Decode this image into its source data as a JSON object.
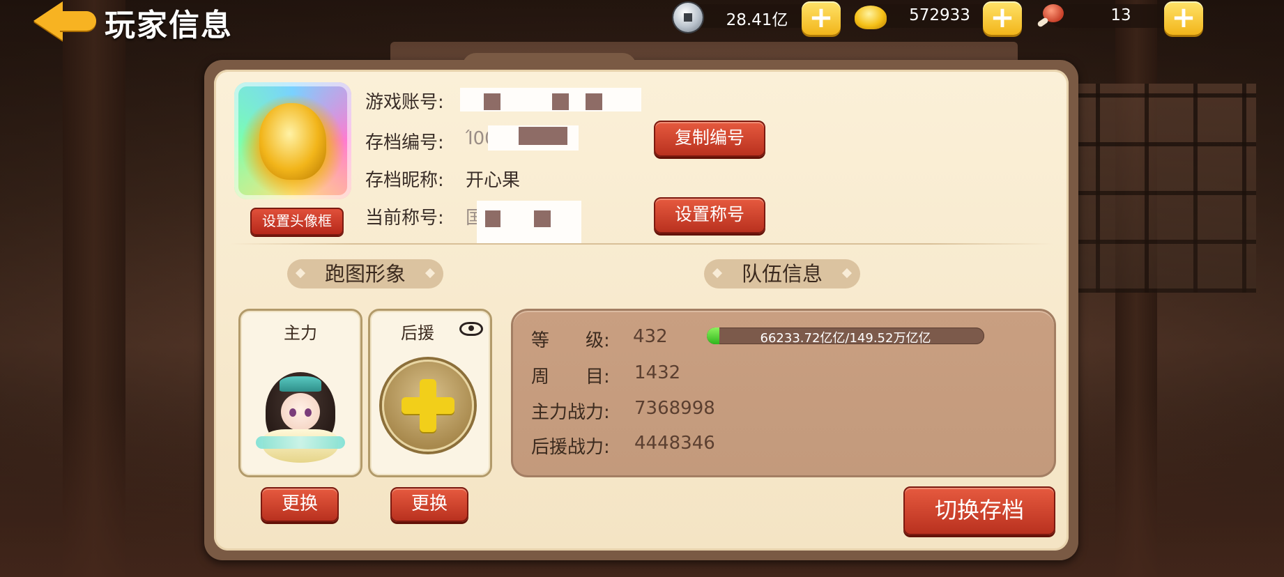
{
  "header": {
    "title": "玩家信息"
  },
  "resources": [
    {
      "name": "silver-coin",
      "value": "28.41亿",
      "icon": "silver-coin-icon"
    },
    {
      "name": "gold-ingot",
      "value": "572933",
      "icon": "gold-ingot-icon"
    },
    {
      "name": "meat",
      "value": "13",
      "icon": "meat-drumstick-icon"
    }
  ],
  "profile": {
    "account_label": "游戏账号:",
    "save_id_label": "存档编号:",
    "save_id_visible": "Ί00",
    "nickname_label": "存档昵称:",
    "nickname": "开心果",
    "title_label": "当前称号:",
    "title_visible": "国",
    "set_avatar_frame": "设置头像框",
    "copy_id": "复制编号",
    "set_title": "设置称号"
  },
  "run_image": {
    "heading": "跑图形象",
    "main_label": "主力",
    "support_label": "后援",
    "change_label": "更换"
  },
  "team": {
    "heading": "队伍信息",
    "level_label": "等　　级:",
    "level": "432",
    "exp_text": "66233.72亿亿/149.52万亿亿",
    "exp_fraction": 0.044,
    "cycle_label": "周　　目:",
    "cycle": "1432",
    "main_power_label": "主力战力:",
    "main_power": "7368998",
    "support_power_label": "后援战力:",
    "support_power": "4448346"
  },
  "footer": {
    "switch_save": "切换存档"
  }
}
